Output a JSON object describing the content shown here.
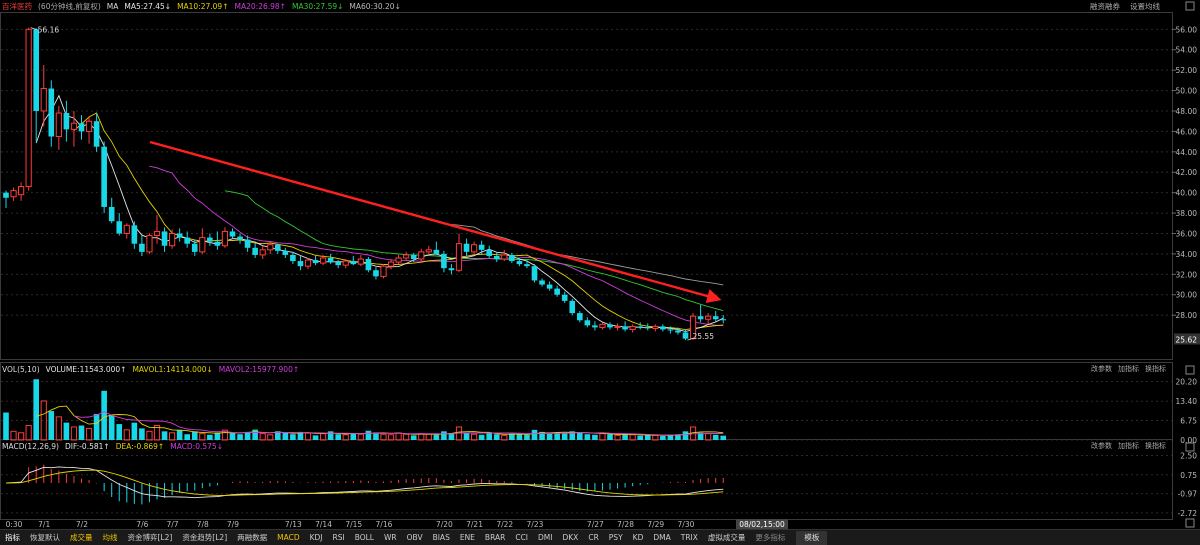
{
  "header": {
    "stock_name": "百洋医药",
    "period": "(60分钟线,前复权)",
    "ma_label": "MA",
    "ma5": "MA5:27.45",
    "ma10": "MA10:27.09",
    "ma20": "MA20:26.98",
    "ma30": "MA30:27.59",
    "ma60": "MA60:30.20",
    "arrow_down": "↓",
    "arrow_up": "↑"
  },
  "top_links": [
    "融资融券",
    "设置均线"
  ],
  "volume_header": {
    "name": "VOL(5,10)",
    "volume": "VOLUME:11543.000",
    "mavol1": "MAVOL1:14114.000",
    "mavol2": "MAVOL2:15977.900"
  },
  "macd_header": {
    "name": "MACD(12,26,9)",
    "dif": "DIF:-0.581",
    "dea": "DEA:-0.869",
    "macd": "MACD:0.575"
  },
  "pane_links": [
    "改参数",
    "加指标",
    "换指标"
  ],
  "price_axis": {
    "ticks": [
      "56.00",
      "54.00",
      "52.00",
      "50.00",
      "48.00",
      "46.00",
      "44.00",
      "42.00",
      "40.00",
      "38.00",
      "36.00",
      "34.00",
      "32.00",
      "30.00",
      "28.00"
    ],
    "current": "25.62",
    "high_label": "56.16",
    "low_label": "25.55"
  },
  "volume_axis": {
    "ticks": [
      "20.20",
      "13.40",
      "6.75",
      "0.00"
    ]
  },
  "macd_axis": {
    "ticks": [
      "2.50",
      "0.75",
      "-0.97",
      "-2.72"
    ]
  },
  "x_axis": {
    "labels": [
      "0:30",
      "7/1",
      "7/2",
      "7/6",
      "7/7",
      "7/8",
      "7/9",
      "7/13",
      "7/14",
      "7/15",
      "7/16",
      "7/20",
      "7/21",
      "7/22",
      "7/23",
      "7/27",
      "7/28",
      "7/29",
      "7/30"
    ],
    "cursor_label": "08/02,15:00"
  },
  "tabs": [
    {
      "label": "指标",
      "cls": "white"
    },
    {
      "label": "恢复默认",
      "cls": ""
    },
    {
      "label": "成交量",
      "cls": "sel"
    },
    {
      "label": "均线",
      "cls": "sel"
    },
    {
      "label": "资金博弈[L2]",
      "cls": ""
    },
    {
      "label": "资金趋势[L2]",
      "cls": ""
    },
    {
      "label": "两融数据",
      "cls": ""
    },
    {
      "label": "MACD",
      "cls": "sel"
    },
    {
      "label": "KDJ",
      "cls": ""
    },
    {
      "label": "RSI",
      "cls": ""
    },
    {
      "label": "BOLL",
      "cls": ""
    },
    {
      "label": "WR",
      "cls": ""
    },
    {
      "label": "OBV",
      "cls": ""
    },
    {
      "label": "BIAS",
      "cls": ""
    },
    {
      "label": "ENE",
      "cls": ""
    },
    {
      "label": "BRAR",
      "cls": ""
    },
    {
      "label": "CCI",
      "cls": ""
    },
    {
      "label": "DMI",
      "cls": ""
    },
    {
      "label": "DKX",
      "cls": ""
    },
    {
      "label": "CR",
      "cls": ""
    },
    {
      "label": "PSY",
      "cls": ""
    },
    {
      "label": "KD",
      "cls": ""
    },
    {
      "label": "DMA",
      "cls": ""
    },
    {
      "label": "TRIX",
      "cls": ""
    },
    {
      "label": "虚拟成交量",
      "cls": ""
    },
    {
      "label": "更多指标",
      "cls": "mute"
    },
    {
      "label": "模板",
      "cls": "boxed"
    }
  ],
  "colors": {
    "up": "#ff3b3b",
    "down": "#19d7e6",
    "ma5": "#e6e6e6",
    "ma10": "#e6d200",
    "ma20": "#d23cdc",
    "ma30": "#32c832",
    "ma60": "#9a9a9a",
    "trend": "#ff2020",
    "dif": "#e6e6e6",
    "dea": "#e6d200",
    "grid": "#2a2a2a"
  },
  "chart_data": {
    "type": "candlestick",
    "candles": [
      [
        0,
        40.0,
        40.2,
        38.5,
        39.5
      ],
      [
        1,
        39.6,
        40.5,
        39.2,
        40.2
      ],
      [
        2,
        39.8,
        41.0,
        39.2,
        40.6
      ],
      [
        3,
        40.6,
        56.16,
        40.2,
        56.0
      ],
      [
        4,
        56.0,
        56.1,
        45.0,
        48.0
      ],
      [
        5,
        48.0,
        52.5,
        46.5,
        50.2
      ],
      [
        6,
        50.2,
        51.0,
        44.5,
        45.5
      ],
      [
        7,
        45.5,
        48.5,
        44.2,
        47.8
      ],
      [
        8,
        47.8,
        49.0,
        45.0,
        46.2
      ],
      [
        9,
        46.2,
        48.0,
        44.5,
        46.8
      ],
      [
        10,
        46.8,
        47.6,
        45.2,
        46.0
      ],
      [
        11,
        46.0,
        47.5,
        44.8,
        47.0
      ],
      [
        12,
        47.0,
        47.8,
        44.0,
        44.5
      ],
      [
        13,
        44.5,
        45.0,
        38.0,
        38.6
      ],
      [
        14,
        38.6,
        39.5,
        37.0,
        37.2
      ],
      [
        15,
        37.2,
        38.0,
        35.8,
        36.0
      ],
      [
        16,
        36.0,
        37.0,
        35.5,
        36.8
      ],
      [
        17,
        36.8,
        37.2,
        34.5,
        35.0
      ],
      [
        18,
        35.0,
        35.8,
        33.8,
        34.2
      ],
      [
        19,
        34.2,
        36.0,
        34.0,
        35.8
      ],
      [
        20,
        35.8,
        37.8,
        35.0,
        36.2
      ],
      [
        21,
        36.2,
        36.6,
        34.2,
        34.8
      ],
      [
        22,
        34.8,
        36.4,
        34.5,
        36.0
      ],
      [
        23,
        36.0,
        36.5,
        35.2,
        35.6
      ],
      [
        24,
        35.6,
        36.2,
        34.6,
        35.0
      ],
      [
        25,
        35.0,
        35.4,
        33.8,
        34.2
      ],
      [
        26,
        34.2,
        36.5,
        34.0,
        35.6
      ],
      [
        27,
        35.6,
        36.0,
        34.8,
        35.2
      ],
      [
        28,
        35.2,
        36.2,
        34.4,
        34.8
      ],
      [
        29,
        34.8,
        36.6,
        34.6,
        36.2
      ],
      [
        30,
        36.2,
        36.5,
        35.5,
        35.7
      ],
      [
        31,
        35.7,
        36.0,
        35.0,
        35.4
      ],
      [
        32,
        35.4,
        35.8,
        34.2,
        34.6
      ],
      [
        33,
        34.6,
        35.0,
        33.6,
        33.9
      ],
      [
        34,
        33.9,
        34.8,
        33.5,
        34.4
      ],
      [
        35,
        34.4,
        35.2,
        34.0,
        34.9
      ],
      [
        36,
        34.9,
        35.0,
        34.0,
        34.3
      ],
      [
        37,
        34.3,
        34.6,
        33.6,
        33.9
      ],
      [
        38,
        33.9,
        34.2,
        33.0,
        33.3
      ],
      [
        39,
        33.3,
        33.8,
        32.4,
        32.8
      ],
      [
        40,
        32.8,
        33.6,
        32.5,
        33.4
      ],
      [
        41,
        33.4,
        33.8,
        32.9,
        33.1
      ],
      [
        42,
        33.1,
        33.9,
        32.9,
        33.6
      ],
      [
        43,
        33.6,
        34.0,
        33.0,
        33.2
      ],
      [
        44,
        33.2,
        33.4,
        32.6,
        32.9
      ],
      [
        45,
        32.9,
        33.5,
        32.6,
        33.3
      ],
      [
        46,
        33.3,
        33.8,
        32.9,
        33.0
      ],
      [
        47,
        33.0,
        33.9,
        32.8,
        33.5
      ],
      [
        48,
        33.5,
        33.7,
        32.2,
        32.4
      ],
      [
        49,
        32.4,
        32.7,
        31.5,
        31.8
      ],
      [
        50,
        31.8,
        33.0,
        31.6,
        32.8
      ],
      [
        51,
        32.8,
        33.5,
        32.5,
        33.2
      ],
      [
        52,
        33.2,
        33.9,
        33.0,
        33.6
      ],
      [
        53,
        33.6,
        34.2,
        33.3,
        33.9
      ],
      [
        54,
        33.9,
        34.1,
        33.2,
        33.5
      ],
      [
        55,
        33.5,
        34.5,
        33.3,
        34.2
      ],
      [
        56,
        34.2,
        34.8,
        33.9,
        34.4
      ],
      [
        57,
        34.4,
        35.2,
        33.9,
        34.0
      ],
      [
        58,
        34.0,
        34.3,
        32.2,
        32.6
      ],
      [
        59,
        32.6,
        33.0,
        32.0,
        32.4
      ],
      [
        60,
        32.4,
        36.0,
        32.2,
        35.0
      ],
      [
        61,
        35.0,
        35.5,
        33.8,
        34.2
      ],
      [
        62,
        34.2,
        35.2,
        33.9,
        34.9
      ],
      [
        63,
        34.9,
        35.3,
        34.0,
        34.4
      ],
      [
        64,
        34.4,
        34.8,
        33.6,
        33.8
      ],
      [
        65,
        33.8,
        34.1,
        33.2,
        33.5
      ],
      [
        66,
        33.5,
        34.4,
        33.3,
        33.9
      ],
      [
        67,
        33.9,
        34.1,
        33.1,
        33.3
      ],
      [
        68,
        33.3,
        33.6,
        32.8,
        33.0
      ],
      [
        69,
        33.0,
        33.4,
        32.6,
        32.8
      ],
      [
        70,
        32.8,
        33.0,
        31.2,
        31.4
      ],
      [
        71,
        31.4,
        31.6,
        30.8,
        31.0
      ],
      [
        72,
        31.0,
        31.3,
        30.4,
        30.6
      ],
      [
        73,
        30.6,
        30.9,
        29.8,
        30.0
      ],
      [
        74,
        30.0,
        30.3,
        29.2,
        29.4
      ],
      [
        75,
        29.4,
        29.6,
        28.0,
        28.2
      ],
      [
        76,
        28.2,
        28.4,
        27.3,
        27.5
      ],
      [
        77,
        27.5,
        27.8,
        26.8,
        27.0
      ],
      [
        78,
        27.0,
        27.4,
        26.5,
        26.8
      ],
      [
        79,
        26.8,
        27.3,
        26.6,
        27.1
      ],
      [
        80,
        27.1,
        27.3,
        26.6,
        26.8
      ],
      [
        81,
        26.8,
        27.2,
        26.5,
        26.9
      ],
      [
        82,
        26.9,
        27.4,
        26.4,
        26.6
      ],
      [
        83,
        26.6,
        27.1,
        26.3,
        26.9
      ],
      [
        84,
        26.9,
        27.3,
        26.6,
        26.8
      ],
      [
        85,
        26.8,
        27.2,
        26.5,
        26.7
      ],
      [
        86,
        26.7,
        27.1,
        26.4,
        26.9
      ],
      [
        87,
        26.9,
        27.1,
        26.4,
        26.6
      ],
      [
        88,
        26.6,
        26.9,
        26.2,
        26.5
      ],
      [
        89,
        26.5,
        26.8,
        26.1,
        26.3
      ],
      [
        90,
        26.3,
        26.6,
        25.55,
        25.7
      ],
      [
        91,
        25.7,
        28.2,
        25.6,
        27.9
      ],
      [
        92,
        27.9,
        29.0,
        27.3,
        27.6
      ],
      [
        93,
        27.6,
        28.2,
        27.1,
        27.9
      ],
      [
        94,
        27.9,
        28.4,
        27.4,
        27.6
      ],
      [
        95,
        27.6,
        28.0,
        27.2,
        27.5
      ]
    ],
    "volume": [
      [
        0,
        9.5
      ],
      [
        1,
        3.0
      ],
      [
        2,
        2.5
      ],
      [
        3,
        5.0
      ],
      [
        4,
        21.0
      ],
      [
        5,
        13.5
      ],
      [
        6,
        10.0
      ],
      [
        7,
        8.0
      ],
      [
        8,
        6.0
      ],
      [
        9,
        4.5
      ],
      [
        10,
        5.0
      ],
      [
        11,
        4.0
      ],
      [
        12,
        9.0
      ],
      [
        13,
        17.0
      ],
      [
        14,
        8.5
      ],
      [
        15,
        5.5
      ],
      [
        16,
        3.5
      ],
      [
        17,
        6.0
      ],
      [
        18,
        4.0
      ],
      [
        19,
        3.0
      ],
      [
        20,
        5.0
      ],
      [
        21,
        3.0
      ],
      [
        22,
        2.5
      ],
      [
        23,
        3.5
      ],
      [
        24,
        2.0
      ],
      [
        25,
        3.0
      ],
      [
        26,
        2.2
      ],
      [
        27,
        1.8
      ],
      [
        28,
        2.6
      ],
      [
        29,
        3.4
      ],
      [
        30,
        2.4
      ],
      [
        31,
        2.0
      ],
      [
        32,
        2.8
      ],
      [
        33,
        3.6
      ],
      [
        34,
        2.2
      ],
      [
        35,
        1.8
      ],
      [
        36,
        3.0
      ],
      [
        37,
        2.6
      ],
      [
        38,
        2.0
      ],
      [
        39,
        2.8
      ],
      [
        40,
        2.4
      ],
      [
        41,
        1.6
      ],
      [
        42,
        2.2
      ],
      [
        43,
        3.0
      ],
      [
        44,
        2.0
      ],
      [
        45,
        1.8
      ],
      [
        46,
        2.4
      ],
      [
        47,
        2.0
      ],
      [
        48,
        3.2
      ],
      [
        49,
        2.6
      ],
      [
        50,
        2.0
      ],
      [
        51,
        1.8
      ],
      [
        52,
        2.4
      ],
      [
        53,
        2.0
      ],
      [
        54,
        1.6
      ],
      [
        55,
        2.2
      ],
      [
        56,
        2.0
      ],
      [
        57,
        1.8
      ],
      [
        58,
        3.0
      ],
      [
        59,
        2.4
      ],
      [
        60,
        4.5
      ],
      [
        61,
        2.6
      ],
      [
        62,
        2.0
      ],
      [
        63,
        1.8
      ],
      [
        64,
        2.4
      ],
      [
        65,
        2.0
      ],
      [
        66,
        1.6
      ],
      [
        67,
        2.2
      ],
      [
        68,
        2.0
      ],
      [
        69,
        1.8
      ],
      [
        70,
        3.5
      ],
      [
        71,
        2.8
      ],
      [
        72,
        2.2
      ],
      [
        73,
        2.6
      ],
      [
        74,
        2.4
      ],
      [
        75,
        3.0
      ],
      [
        76,
        2.6
      ],
      [
        77,
        2.0
      ],
      [
        78,
        1.8
      ],
      [
        79,
        2.2
      ],
      [
        80,
        2.0
      ],
      [
        81,
        1.6
      ],
      [
        82,
        2.0
      ],
      [
        83,
        1.8
      ],
      [
        84,
        1.5
      ],
      [
        85,
        1.8
      ],
      [
        86,
        1.6
      ],
      [
        87,
        1.4
      ],
      [
        88,
        1.8
      ],
      [
        89,
        2.0
      ],
      [
        90,
        3.0
      ],
      [
        91,
        4.5
      ],
      [
        92,
        2.5
      ],
      [
        93,
        2.2
      ],
      [
        94,
        1.8
      ],
      [
        95,
        1.5
      ]
    ],
    "ylim": [
      24.0,
      57.5
    ],
    "volume_ylim": [
      0,
      23.5
    ],
    "macd_ylim": [
      -3.0,
      3.0
    ]
  }
}
